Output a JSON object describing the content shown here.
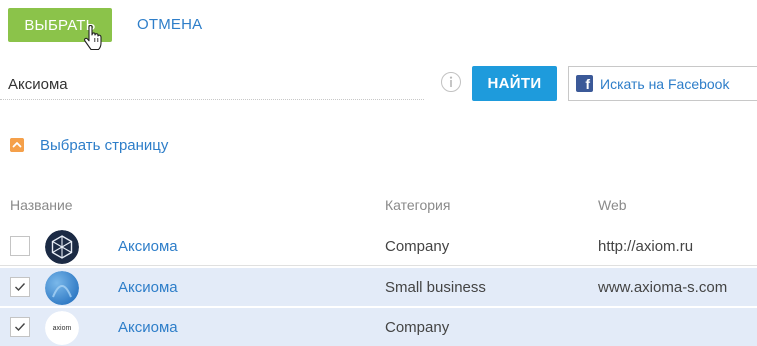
{
  "toolbar": {
    "select_label": "ВЫБРАТЬ",
    "cancel_label": "ОТМЕНА"
  },
  "search": {
    "value": "Аксиома",
    "find_label": "НАЙТИ",
    "facebook_label": "Искать на Facebook"
  },
  "select_page_label": "Выбрать страницу",
  "table": {
    "headers": {
      "name": "Название",
      "category": "Категория",
      "web": "Web"
    },
    "rows": [
      {
        "name": "Аксиома",
        "category": "Company",
        "web": "http://axiom.ru",
        "checked": false,
        "logo": "axiom-dark-logo"
      },
      {
        "name": "Аксиома",
        "category": "Small business",
        "web": "www.axioma-s.com",
        "checked": true,
        "logo": "blue-sphere-logo"
      },
      {
        "name": "Аксиома",
        "category": "Company",
        "web": "",
        "checked": true,
        "logo": "axiom-text-logo"
      }
    ]
  },
  "icons": {
    "info": "info-icon",
    "facebook": "facebook-icon",
    "expand": "chevron-up-icon",
    "check": "checkmark-icon",
    "cursor": "hand-pointer-icon"
  },
  "colors": {
    "select_button": "#8bc34a",
    "find_button": "#1e9bdc",
    "link": "#2e7ec9",
    "selected_row": "#e3ebf8",
    "expand_icon": "#f5a04a",
    "facebook": "#3b5998"
  },
  "logo_text": "axiom"
}
